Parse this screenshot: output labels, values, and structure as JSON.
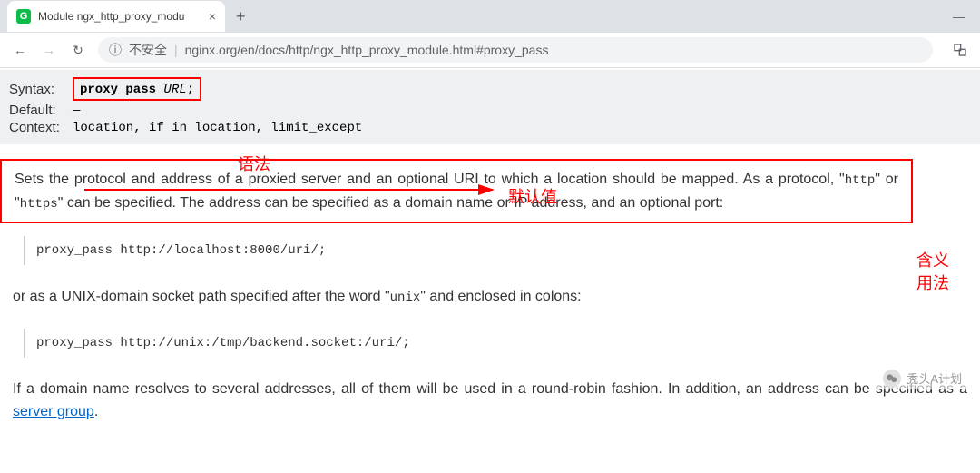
{
  "browser": {
    "favicon_letter": "G",
    "tab_title": "Module ngx_http_proxy_modu",
    "close_glyph": "×",
    "new_tab_glyph": "+",
    "minimize_glyph": "—",
    "nav": {
      "back": "←",
      "forward": "→",
      "reload": "↻",
      "info": "ⓘ",
      "insecure": "不安全",
      "separator": "|",
      "url": "nginx.org/en/docs/http/ngx_http_proxy_module.html#proxy_pass",
      "translate": "⠿"
    }
  },
  "directive": {
    "syntax_label": "Syntax:",
    "syntax_cmd": "proxy_pass",
    "syntax_arg": "URL",
    "syntax_semicolon": ";",
    "default_label": "Default:",
    "default_value": "—",
    "context_label": "Context:",
    "context_value": "location, if in location, limit_except"
  },
  "annotations": {
    "syntax": "语法",
    "default": "默认值",
    "meaning": "含义用法"
  },
  "para1": {
    "t1": "Sets the protocol and address of a proxied server and an optional URI to which a location should be mapped. As a protocol, \"",
    "c1": "http",
    "t2": "\" or \"",
    "c2": "https",
    "t3": "\" can be specified. The address can be specified as a domain name or IP address, and an optional port:"
  },
  "code1": "proxy_pass http://localhost:8000/uri/;",
  "para2": {
    "t1": "or as a UNIX-domain socket path specified after the word \"",
    "c1": "unix",
    "t2": "\" and enclosed in colons:"
  },
  "code2": "proxy_pass http://unix:/tmp/backend.socket:/uri/;",
  "para3": {
    "t1": "If a domain name resolves to several addresses, all of them will be used in a round-robin fashion. In addition, an address can be specified as a ",
    "link": "server group",
    "t2": "."
  },
  "watermark": "秃头A计划"
}
